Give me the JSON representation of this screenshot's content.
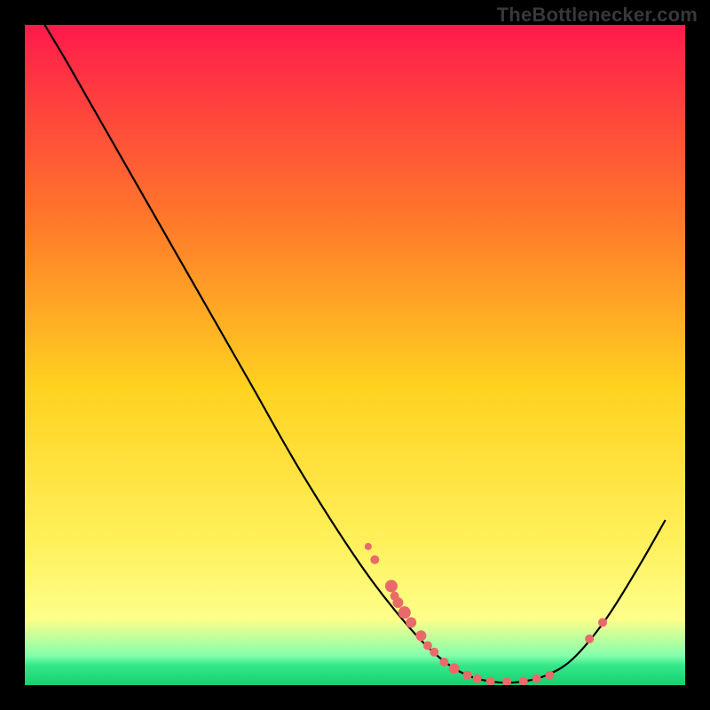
{
  "watermark": "TheBottlenecker.com",
  "chart_data": {
    "type": "line",
    "title": "",
    "xlabel": "",
    "ylabel": "",
    "xlim": [
      0,
      100
    ],
    "ylim": [
      0,
      100
    ],
    "background_gradient": [
      "#ff1a4b",
      "#ff9a1f",
      "#ffe71f",
      "#fffd5a",
      "#6bff9a",
      "#1ee07a"
    ],
    "series": [
      {
        "name": "bottleneck-curve",
        "color": "#000000",
        "points": [
          {
            "x": 3,
            "y": 100
          },
          {
            "x": 6,
            "y": 95
          },
          {
            "x": 10,
            "y": 88
          },
          {
            "x": 18,
            "y": 74
          },
          {
            "x": 26,
            "y": 60
          },
          {
            "x": 34,
            "y": 46
          },
          {
            "x": 42,
            "y": 32
          },
          {
            "x": 51,
            "y": 18
          },
          {
            "x": 58,
            "y": 9
          },
          {
            "x": 63,
            "y": 4
          },
          {
            "x": 67,
            "y": 1.5
          },
          {
            "x": 71,
            "y": 0.5
          },
          {
            "x": 75,
            "y": 0.5
          },
          {
            "x": 79,
            "y": 1.5
          },
          {
            "x": 83,
            "y": 4
          },
          {
            "x": 88,
            "y": 10
          },
          {
            "x": 93,
            "y": 18
          },
          {
            "x": 97,
            "y": 25
          }
        ]
      }
    ],
    "scatter": [
      {
        "x": 52,
        "y": 21,
        "r": 4
      },
      {
        "x": 53,
        "y": 19,
        "r": 5
      },
      {
        "x": 55.5,
        "y": 15,
        "r": 7
      },
      {
        "x": 56,
        "y": 13.5,
        "r": 5
      },
      {
        "x": 56.5,
        "y": 12.5,
        "r": 6
      },
      {
        "x": 57.5,
        "y": 11,
        "r": 7
      },
      {
        "x": 58.5,
        "y": 9.5,
        "r": 6
      },
      {
        "x": 60,
        "y": 7.5,
        "r": 6
      },
      {
        "x": 61,
        "y": 6,
        "r": 5
      },
      {
        "x": 62,
        "y": 5,
        "r": 5
      },
      {
        "x": 63.5,
        "y": 3.5,
        "r": 5
      },
      {
        "x": 65,
        "y": 2.5,
        "r": 6
      },
      {
        "x": 67,
        "y": 1.5,
        "r": 5
      },
      {
        "x": 68.5,
        "y": 1,
        "r": 5
      },
      {
        "x": 70.5,
        "y": 0.6,
        "r": 5
      },
      {
        "x": 73,
        "y": 0.5,
        "r": 5
      },
      {
        "x": 75.5,
        "y": 0.6,
        "r": 5
      },
      {
        "x": 77.5,
        "y": 1,
        "r": 5
      },
      {
        "x": 79.5,
        "y": 1.5,
        "r": 5
      },
      {
        "x": 85.5,
        "y": 7,
        "r": 5
      },
      {
        "x": 87.5,
        "y": 9.5,
        "r": 5
      }
    ],
    "scatter_color": "#ea6a6a"
  }
}
